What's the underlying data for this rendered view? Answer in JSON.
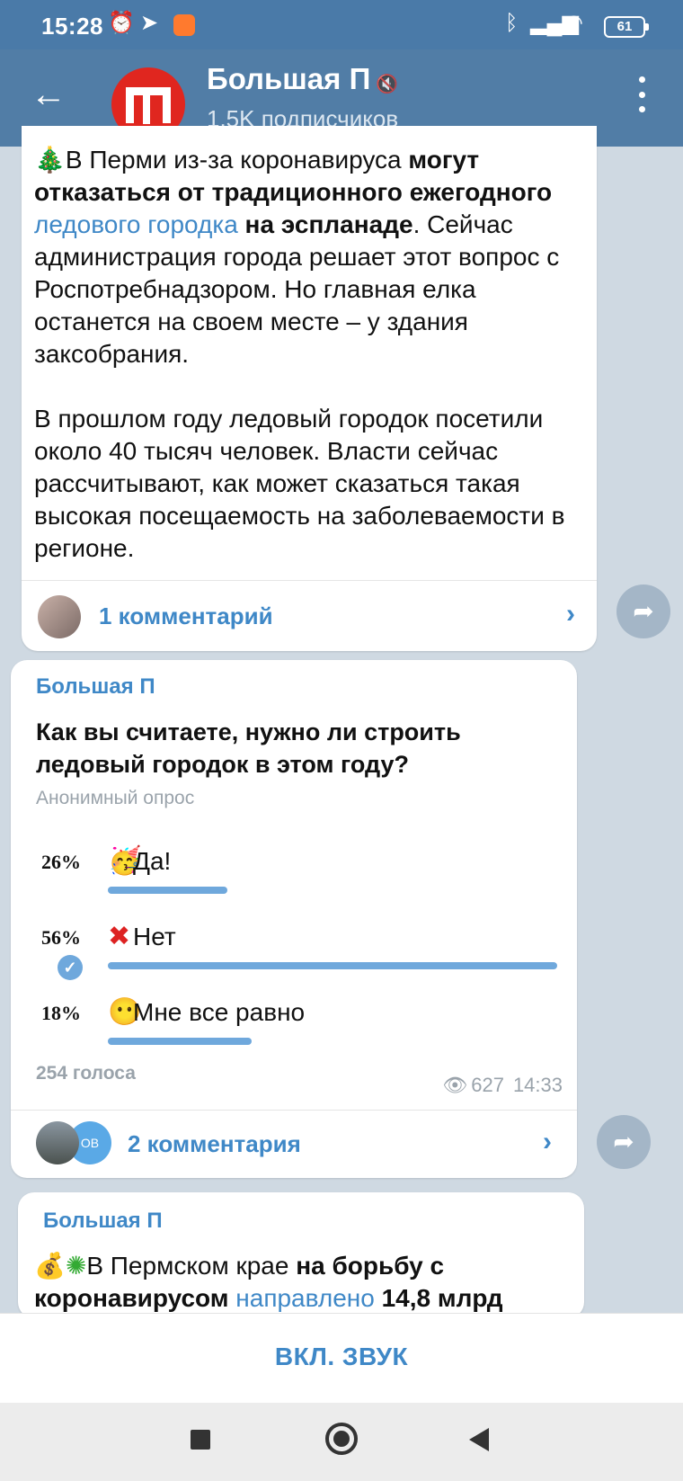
{
  "status_bar": {
    "time": "15:28",
    "battery": "61"
  },
  "header": {
    "title": "Большая П",
    "subtitle": "1.5K подписчиков"
  },
  "post1": {
    "line1_a": "В Перми из-за коронавируса ",
    "line1_b": "могут отказаться от традиционного ежегодного",
    "link": "ледового городка",
    "bold2": " на эспланаде",
    "rest": ". Сейчас администрация города решает этот вопрос с Роспотребнадзором. Но главная елка останется на своем месте – у здания заксобрания.",
    "para2": "В прошлом году ледовый городок посетили около 40 тысяч человек. Власти сейчас рассчитывают, как может сказаться такая высокая посещаемость на заболеваемости в регионе.",
    "comments": "1 комментарий"
  },
  "post2": {
    "sender": "Большая П",
    "question": "Как вы считаете, нужно ли строить ледовый городок в этом году?",
    "poll_type": "Анонимный опрос",
    "options": [
      {
        "pct": "26%",
        "label": "Да!",
        "fraction": 0.26
      },
      {
        "pct": "56%",
        "label": "Нет",
        "fraction": 0.56
      },
      {
        "pct": "18%",
        "label": "Мне все равно",
        "fraction": 0.18
      }
    ],
    "votes": "254 голоса",
    "views": "627",
    "time": "14:33",
    "comments": "2 комментария",
    "avatar2_text": "ОВ"
  },
  "post3": {
    "sender": "Большая П",
    "text_a": "В Пермском крае ",
    "text_b": "на борьбу с коронавирусом",
    "text_link": " направлено",
    "text_c": " 14,8 млрд"
  },
  "unmute": "ВКЛ. ЗВУК"
}
